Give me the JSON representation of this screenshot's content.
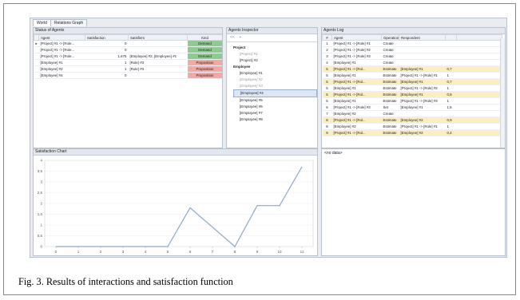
{
  "tabs": [
    "World",
    "Relations Graph"
  ],
  "status_panel": {
    "title": "Status of Agents",
    "columns": [
      "Agent",
      "Satisfaction",
      "Satisfiers",
      "Kind"
    ],
    "rows": [
      {
        "agent": "[Project] #1 -> [Role...",
        "satisfaction": "0",
        "satisfiers": "",
        "kind": "Demand"
      },
      {
        "agent": "[Project] #1 -> [Role...",
        "satisfaction": "0",
        "satisfiers": "",
        "kind": "Demand"
      },
      {
        "agent": "[Project] #1 -> [Role...",
        "satisfaction": "1,675",
        "satisfiers": "[Employee] #2, [Employee] #1",
        "kind": "Demand"
      },
      {
        "agent": "[Employee] #1",
        "satisfaction": "1",
        "satisfiers": "[Role] #3",
        "kind": "Proposition"
      },
      {
        "agent": "[Employee] #2",
        "satisfaction": "1",
        "satisfiers": "[Role] #3",
        "kind": "Proposition"
      },
      {
        "agent": "[Employee] #4",
        "satisfaction": "0",
        "satisfiers": "",
        "kind": "Proposition"
      }
    ]
  },
  "inspector": {
    "title": "Agents Inspector",
    "nav": [
      "<<",
      "+"
    ],
    "project_label": "Project",
    "projects": [
      "[Project] #1",
      "[Project] #2"
    ],
    "employee_label": "Employee",
    "employees": [
      "[Employee] #1",
      "[Employee] #2",
      "[Employee] #3",
      "[Employee] #4",
      "[Employee] #5",
      "[Employee] #6",
      "[Employee] #7",
      "[Employee] #8"
    ]
  },
  "log": {
    "title": "Agents Log",
    "columns": [
      "#",
      "Agent",
      "Operation",
      "Respondent",
      ""
    ],
    "rows": [
      {
        "n": "1",
        "agent": "[Project] #1 -> [Role] #1",
        "op": "Create",
        "resp": "",
        "val": ""
      },
      {
        "n": "2",
        "agent": "[Project] #1 -> [Role] #2",
        "op": "Create",
        "resp": "",
        "val": ""
      },
      {
        "n": "3",
        "agent": "[Project] #1 -> [Role] #3",
        "op": "Create",
        "resp": "",
        "val": ""
      },
      {
        "n": "4",
        "agent": "[Employee] #1",
        "op": "Create",
        "resp": "",
        "val": ""
      },
      {
        "n": "5",
        "agent": "[Project] #1 -> [Rol...",
        "op": "Estimate",
        "resp": "[Employee] #1",
        "val": "0,7"
      },
      {
        "n": "5",
        "agent": "[Employee] #1",
        "op": "Estimate",
        "resp": "[Project] #1 -> [Role] #1",
        "val": "1"
      },
      {
        "n": "5",
        "agent": "[Project] #1 -> [Rol...",
        "op": "Estimate",
        "resp": "[Employee] #1",
        "val": "0,7"
      },
      {
        "n": "5",
        "agent": "[Employee] #1",
        "op": "Estimate",
        "resp": "[Project] #1 -> [Role] #2",
        "val": "1"
      },
      {
        "n": "5",
        "agent": "[Project] #1 -> [Rol...",
        "op": "Estimate",
        "resp": "[Employee] #1",
        "val": "0,8"
      },
      {
        "n": "5",
        "agent": "[Employee] #1",
        "op": "Estimate",
        "resp": "[Project] #1 -> [Role] #3",
        "val": "1"
      },
      {
        "n": "6",
        "agent": "[Project] #1 -> [Role] #3",
        "op": "Set",
        "resp": "[Employee] #1",
        "val": "1,8"
      },
      {
        "n": "7",
        "agent": "[Employee] #2",
        "op": "Create",
        "resp": "",
        "val": ""
      },
      {
        "n": "8",
        "agent": "[Project] #1 -> [Rol...",
        "op": "Estimate",
        "resp": "[Employee] #2",
        "val": "0,9"
      },
      {
        "n": "8",
        "agent": "[Employee] #2",
        "op": "Estimate",
        "resp": "[Project] #1 -> [Role] #1",
        "val": "1"
      },
      {
        "n": "9",
        "agent": "[Project] #1 -> [Rol...",
        "op": "Estimate",
        "resp": "[Employee] #2",
        "val": "0,4"
      }
    ],
    "highlighted": [
      4,
      6,
      8,
      12,
      14
    ],
    "empty_label": "<no data>"
  },
  "chart_panel": {
    "title": "Satisfaction Chart"
  },
  "chart_data": {
    "type": "line",
    "x": [
      0,
      1,
      2,
      3,
      4,
      5,
      6,
      7,
      8,
      9,
      10,
      11
    ],
    "y": [
      0,
      0,
      0,
      0,
      0,
      0,
      1.8,
      0.9,
      0,
      1.9,
      1.9,
      3.7
    ],
    "xticks": [
      "0",
      "1",
      "2",
      "3",
      "4",
      "5",
      "6",
      "7",
      "8",
      "9",
      "10",
      "11"
    ],
    "yticks": [
      "0",
      "0,5",
      "1",
      "1,5",
      "2",
      "2,5",
      "3",
      "3,5",
      "4"
    ],
    "ylim": [
      0,
      4
    ],
    "xlim": [
      -0.5,
      11.5
    ],
    "line_color": "#8fa8c8"
  },
  "caption": "Fig. 3.   Results of interactions and satisfaction function"
}
